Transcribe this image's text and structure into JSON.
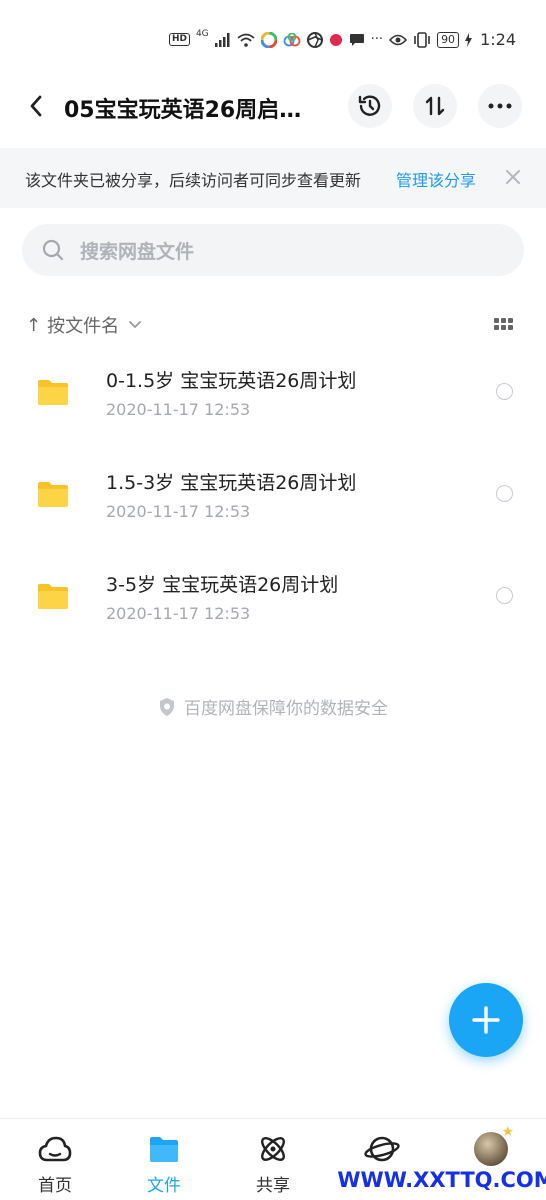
{
  "status_bar": {
    "hd_label": "HD",
    "network_label": "4G",
    "more_label": "···",
    "battery": "90",
    "time": "1:24"
  },
  "header": {
    "title": "05宝宝玩英语26周启…",
    "back_icon": "chevron-left-icon",
    "history_icon": "history-icon",
    "sort_icon": "transfer-sort-icon",
    "more_icon": "more-dots-icon"
  },
  "share_banner": {
    "text": "该文件夹已被分享，后续访问者可同步查看更新",
    "manage_label": "管理该分享",
    "close_icon": "close-icon",
    "accent_color": "#1e9bf0"
  },
  "search": {
    "placeholder": "搜索网盘文件",
    "icon": "search-icon"
  },
  "sort": {
    "arrow": "↑",
    "label": "按文件名",
    "view_toggle_icon": "grid-view-icon"
  },
  "files": [
    {
      "name": "0-1.5岁 宝宝玩英语26周计划",
      "date": "2020-11-17  12:53",
      "icon": "folder-icon"
    },
    {
      "name": "1.5-3岁 宝宝玩英语26周计划",
      "date": "2020-11-17  12:53",
      "icon": "folder-icon"
    },
    {
      "name": "3-5岁 宝宝玩英语26周计划",
      "date": "2020-11-17  12:53",
      "icon": "folder-icon"
    }
  ],
  "safety_note": "百度网盘保障你的数据安全",
  "fab": {
    "icon": "plus-icon",
    "color": "#1aa6f5"
  },
  "bottom_nav": {
    "items": [
      {
        "label": "首页",
        "icon": "home-cloud-icon",
        "active": false
      },
      {
        "label": "文件",
        "icon": "folder-icon",
        "active": true
      },
      {
        "label": "共享",
        "icon": "atom-share-icon",
        "active": false
      },
      {
        "label": "",
        "icon": "planet-icon",
        "active": false
      },
      {
        "label": "",
        "icon": "avatar-icon",
        "active": false
      }
    ],
    "active_color": "#1aa6f5"
  },
  "watermark": "WWW.XXTTQ.COM"
}
